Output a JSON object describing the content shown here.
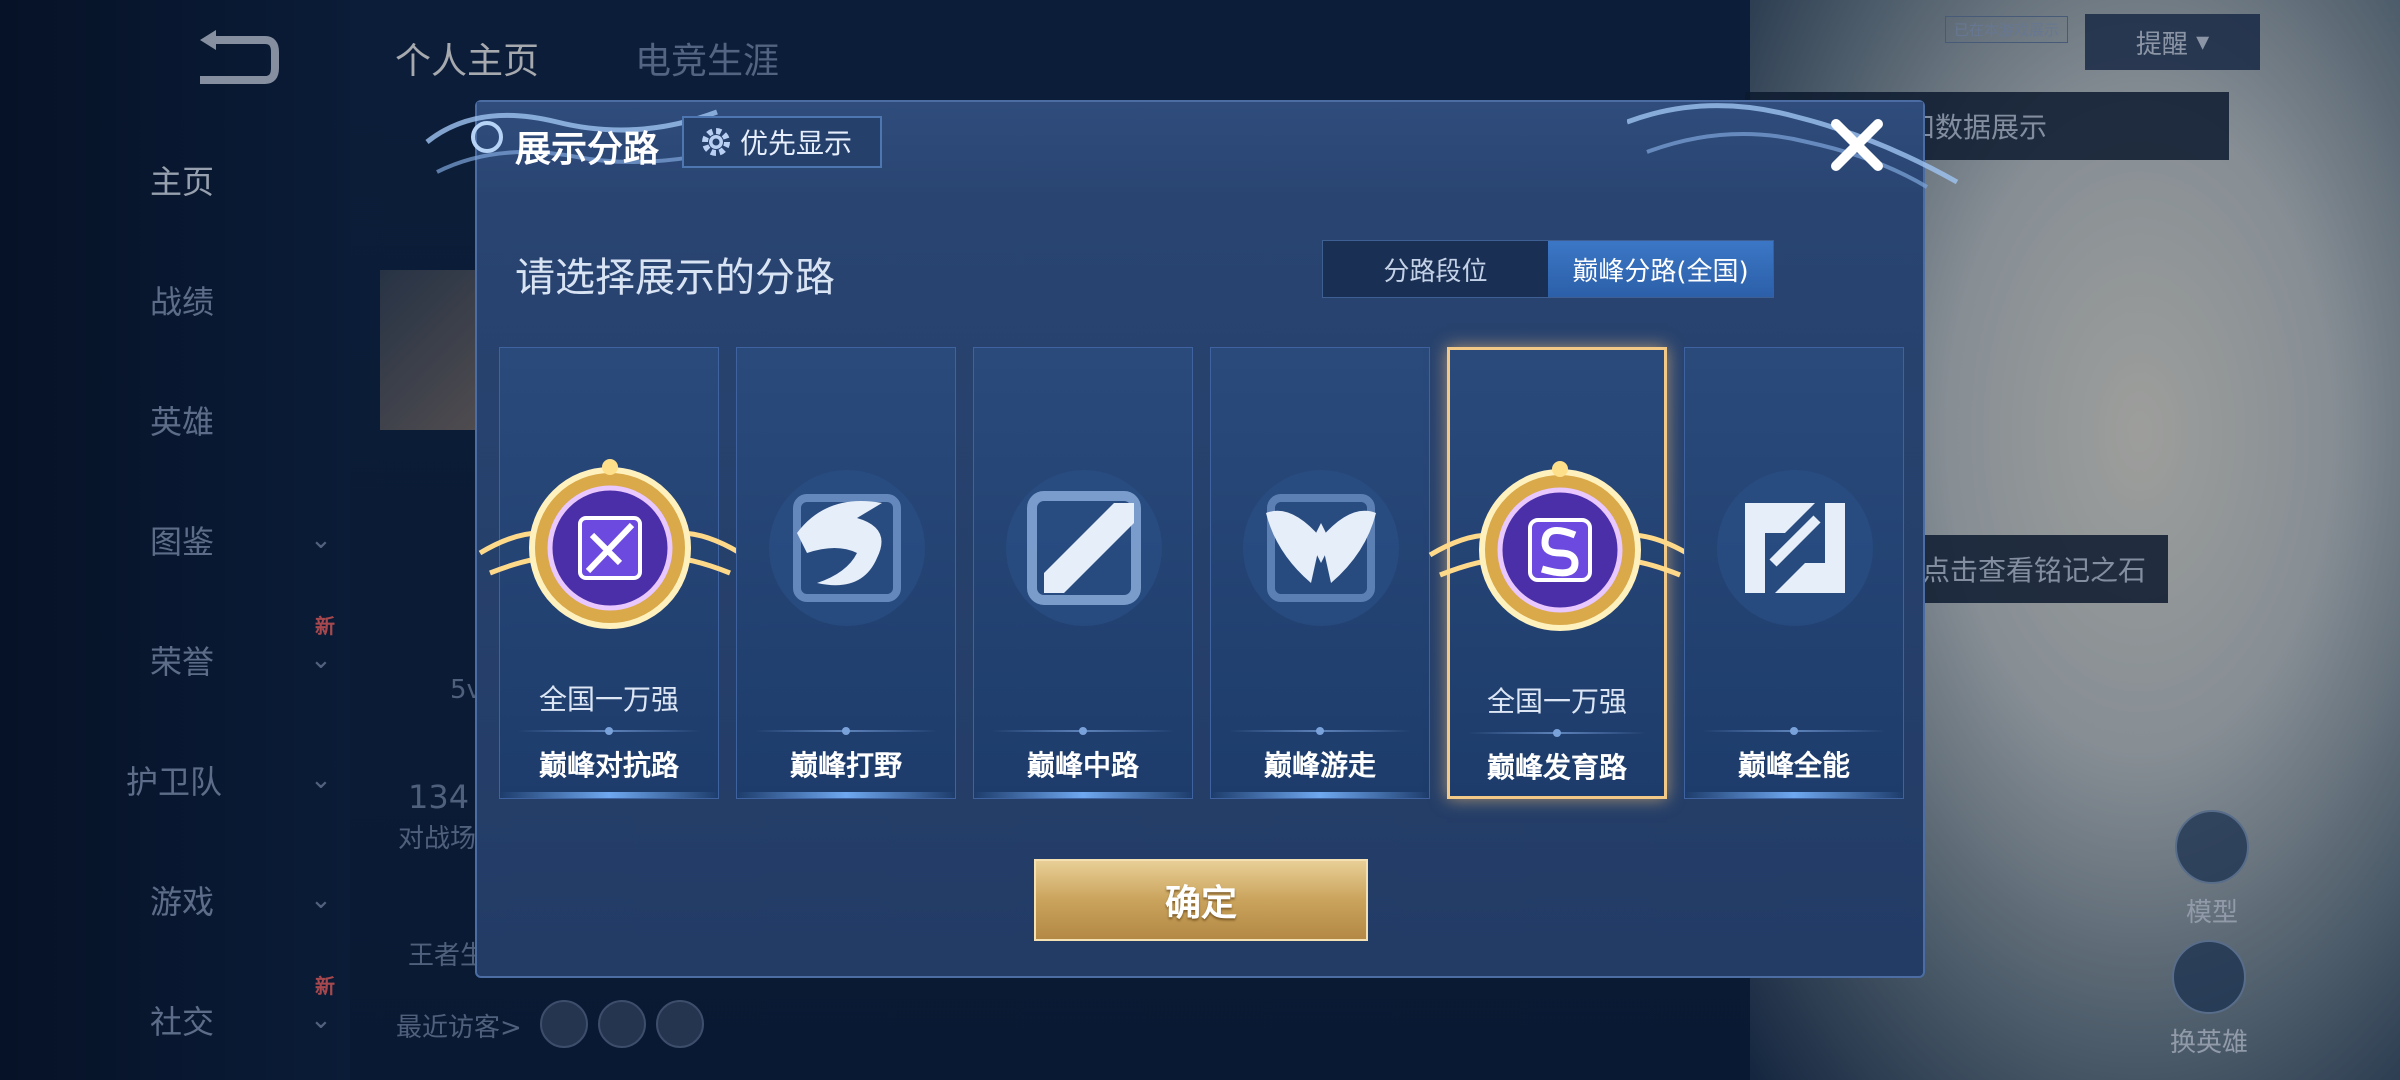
{
  "background": {
    "tabs": [
      "个人主页",
      "电竞生涯"
    ],
    "sidebar": [
      {
        "label": "主页",
        "active": true,
        "chevron": false,
        "new": false
      },
      {
        "label": "战绩",
        "active": false,
        "chevron": false,
        "new": false
      },
      {
        "label": "英雄",
        "active": false,
        "chevron": false,
        "new": false
      },
      {
        "label": "图鉴",
        "active": false,
        "chevron": true,
        "new": false
      },
      {
        "label": "荣誉",
        "active": false,
        "chevron": true,
        "new": true
      },
      {
        "label": "护卫队",
        "active": false,
        "chevron": true,
        "new": false
      },
      {
        "label": "游戏",
        "active": false,
        "chevron": true,
        "new": false
      },
      {
        "label": "社交",
        "active": false,
        "chevron": true,
        "new": true
      }
    ],
    "new_badge": "新",
    "partial_texts": {
      "stat_1": "5v",
      "stat_2": "134",
      "stat_3": "对战场",
      "stat_4": "王者生"
    },
    "recent_visitors": "最近访客>",
    "right_tip_1": "以切换灵宝和数据展示",
    "right_tip_2": "点击查看铭记之石",
    "right_btn_model": "模型",
    "right_btn_switch": "换英雄",
    "top_small_label": "已在本游戏展示",
    "top_dropdown": "提醒"
  },
  "modal": {
    "title": "展示分路",
    "priority_button": "优先显示",
    "prompt": "请选择展示的分路",
    "segment": [
      {
        "label": "分路段位",
        "active": false
      },
      {
        "label": "巅峰分路(全国)",
        "active": true
      }
    ],
    "cards": [
      {
        "name": "巅峰对抗路",
        "sub": "全国一万强",
        "icon": "peak-top-lane-gold-badge-icon",
        "selected": false
      },
      {
        "name": "巅峰打野",
        "sub": "",
        "icon": "peak-jungle-dragon-icon",
        "selected": false
      },
      {
        "name": "巅峰中路",
        "sub": "",
        "icon": "peak-mid-lane-icon",
        "selected": false
      },
      {
        "name": "巅峰游走",
        "sub": "",
        "icon": "peak-roam-wings-icon",
        "selected": false
      },
      {
        "name": "巅峰发育路",
        "sub": "全国一万强",
        "icon": "peak-bot-lane-gold-badge-icon",
        "selected": true
      },
      {
        "name": "巅峰全能",
        "sub": "",
        "icon": "peak-all-round-icon",
        "selected": false
      }
    ],
    "confirm_button": "确定"
  },
  "colors": {
    "selected_border": "#f3c987",
    "segment_active": "#3b77c6",
    "confirm_gold": "#caa35c"
  }
}
